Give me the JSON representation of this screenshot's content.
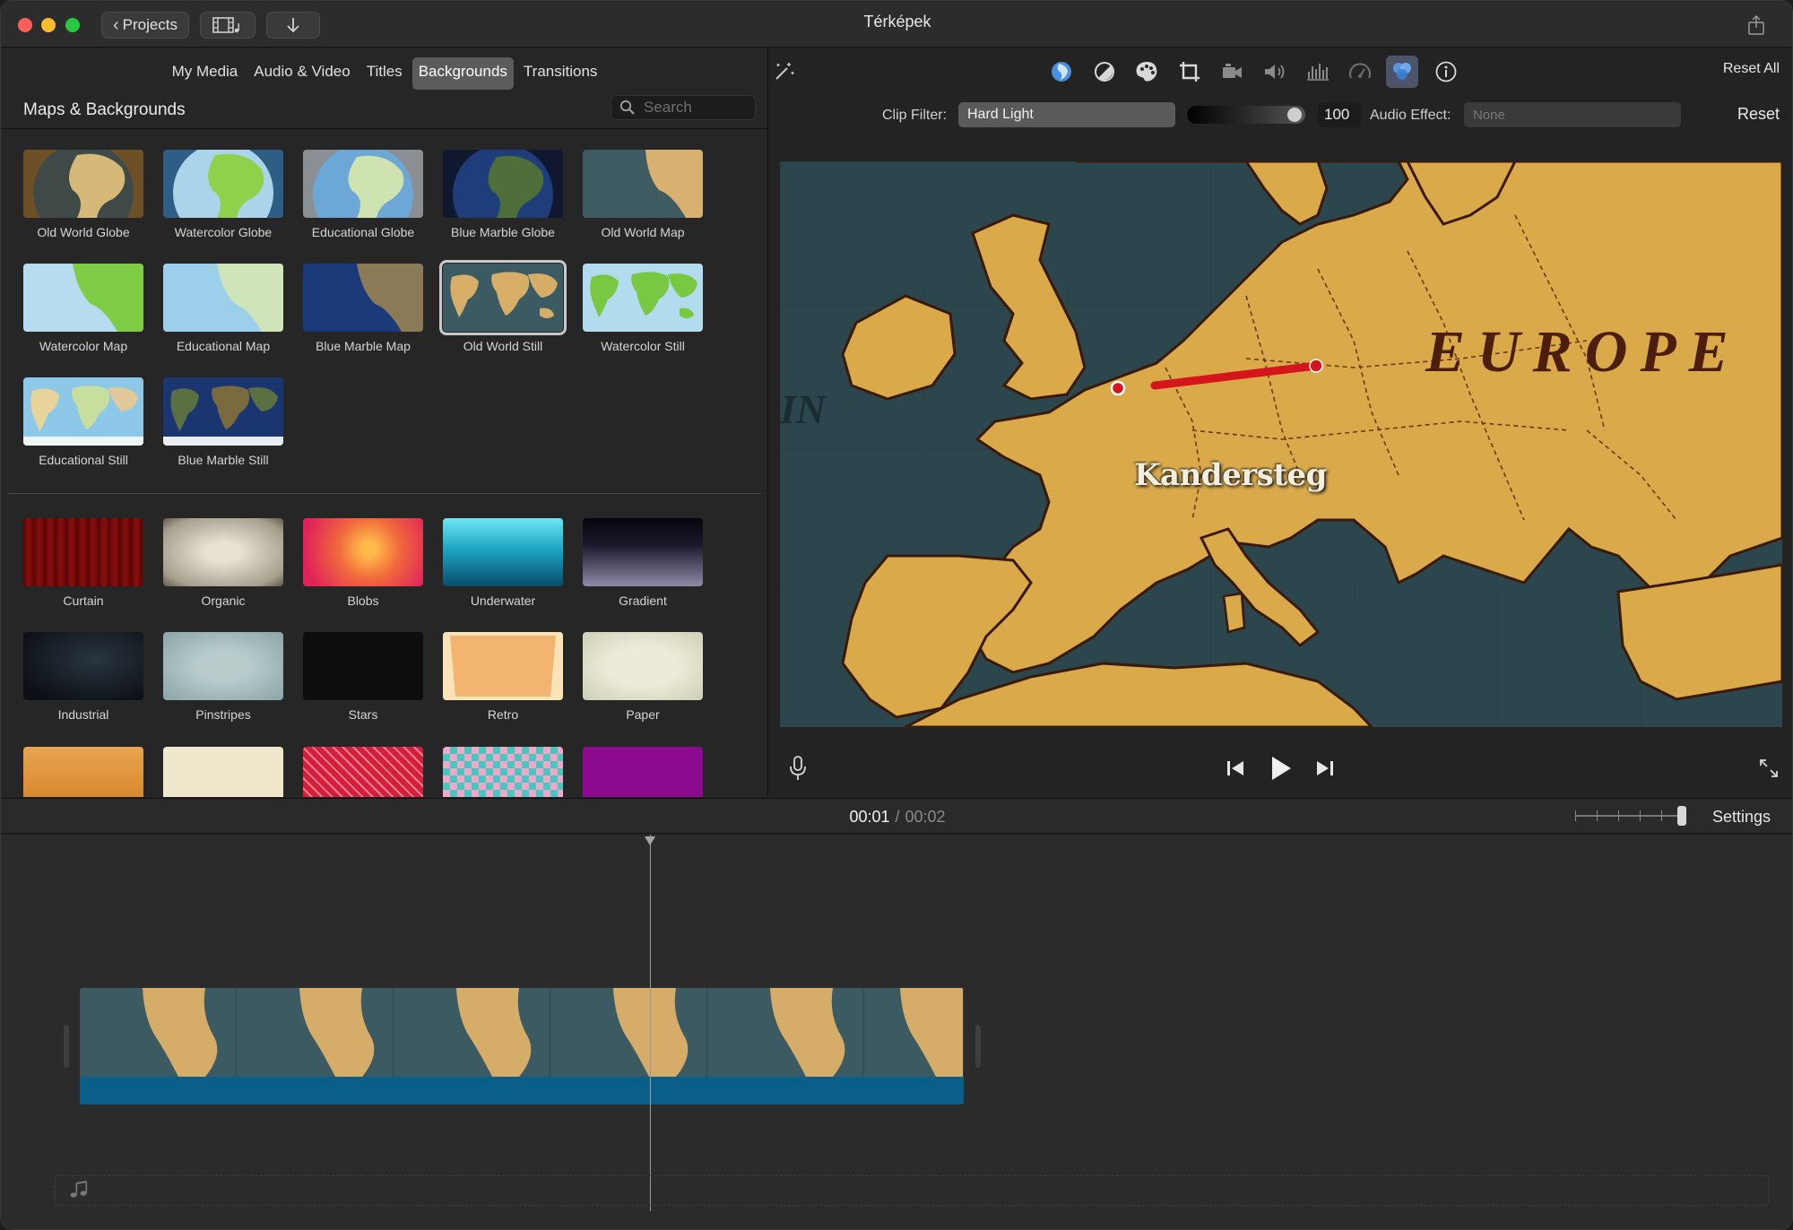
{
  "window": {
    "title": "Térképek",
    "projects_label": "Projects"
  },
  "browser": {
    "tabs": [
      {
        "label": "My Media"
      },
      {
        "label": "Audio & Video"
      },
      {
        "label": "Titles"
      },
      {
        "label": "Backgrounds",
        "active": true
      },
      {
        "label": "Transitions"
      }
    ],
    "section_title": "Maps & Backgrounds",
    "search_placeholder": "Search",
    "maps": [
      {
        "label": "Old World Globe"
      },
      {
        "label": "Watercolor Globe"
      },
      {
        "label": "Educational Globe"
      },
      {
        "label": "Blue Marble Globe"
      },
      {
        "label": "Old World Map"
      },
      {
        "label": "Watercolor Map"
      },
      {
        "label": "Educational Map"
      },
      {
        "label": "Blue Marble Map"
      },
      {
        "label": "Old World Still",
        "selected": true
      },
      {
        "label": "Watercolor Still"
      },
      {
        "label": "Educational Still"
      },
      {
        "label": "Blue Marble Still"
      }
    ],
    "backgrounds": [
      {
        "label": "Curtain"
      },
      {
        "label": "Organic"
      },
      {
        "label": "Blobs"
      },
      {
        "label": "Underwater"
      },
      {
        "label": "Gradient"
      },
      {
        "label": "Industrial"
      },
      {
        "label": "Pinstripes"
      },
      {
        "label": "Stars"
      },
      {
        "label": "Retro"
      },
      {
        "label": "Paper"
      }
    ]
  },
  "viewer": {
    "toolbar_icons": [
      "magic-wand-icon",
      "color-balance-icon",
      "color-correction-icon",
      "color-palette-icon",
      "crop-icon",
      "stabilization-icon",
      "volume-icon",
      "noise-reduction-icon",
      "speed-icon",
      "clip-filter-icon",
      "info-icon"
    ],
    "reset_all_label": "Reset All",
    "clip_filter_label": "Clip Filter:",
    "clip_filter_value": "Hard Light",
    "filter_amount": "100",
    "audio_effect_label": "Audio Effect:",
    "audio_effect_value": "None",
    "reset_label": "Reset",
    "preview": {
      "city_label": "Kandersteg",
      "region_label": "EUROPE",
      "ocean_label": "IN"
    }
  },
  "timeline": {
    "current_time": "00:01",
    "separator": "/",
    "total_time": "00:02",
    "settings_label": "Settings"
  },
  "colors": {
    "accent_blue": "#4a90e2",
    "audio_track": "#0a5f8a",
    "route_red": "#d4151b",
    "map_land": "#d9a94a",
    "map_sea": "#28444a"
  }
}
